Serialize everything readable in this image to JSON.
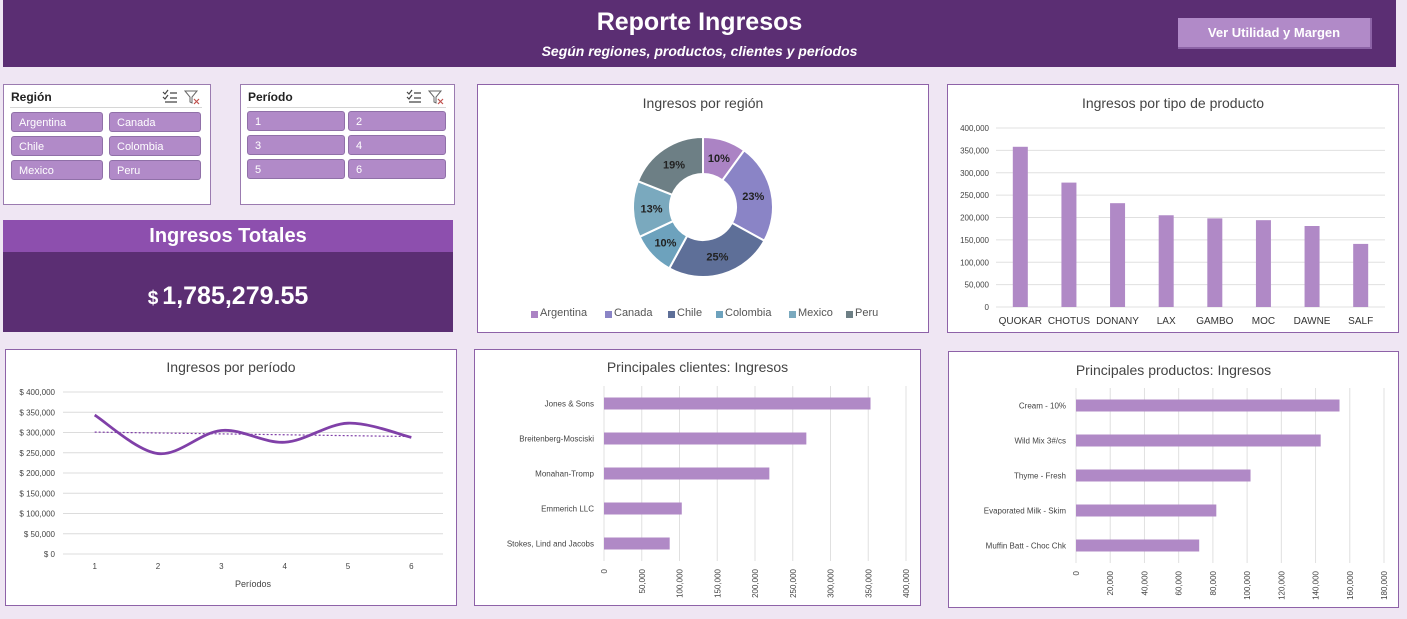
{
  "header": {
    "title": "Reporte Ingresos",
    "subtitle": "Según regiones, productos, clientes y períodos",
    "button_label": "Ver Utilidad y Margen"
  },
  "slicer_region": {
    "title": "Región",
    "items": [
      "Argentina",
      "Canada",
      "Chile",
      "Colombia",
      "Mexico",
      "Peru"
    ],
    "icons": [
      "multi-select-icon",
      "clear-filter-icon"
    ]
  },
  "slicer_periodo": {
    "title": "Período",
    "items": [
      "1",
      "2",
      "3",
      "4",
      "5",
      "6"
    ],
    "icons": [
      "multi-select-icon",
      "clear-filter-icon"
    ]
  },
  "kpi": {
    "title": "Ingresos Totales",
    "currency": "$",
    "value": "1,785,279.55"
  },
  "colors": {
    "header": "#5b2e73",
    "accent": "#b18ac8",
    "bar": "#b089c6",
    "line": "#8040a8",
    "background": "#efe6f3"
  },
  "chart_data": [
    {
      "id": "region",
      "type": "pie",
      "title": "Ingresos por región",
      "donut": true,
      "legend": "bottom",
      "labels": [
        "Argentina",
        "Canada",
        "Chile",
        "Colombia",
        "Mexico",
        "Peru"
      ],
      "values": [
        10,
        23,
        25,
        10,
        13,
        19
      ],
      "value_labels": [
        "10%",
        "23%",
        "25%",
        "10%",
        "13%",
        "19%"
      ],
      "colors": [
        "#ab83c4",
        "#8a84c6",
        "#5e6f98",
        "#6da2bd",
        "#7aa9be",
        "#6d7f85"
      ]
    },
    {
      "id": "producto",
      "type": "bar",
      "title": "Ingresos por tipo de producto",
      "orientation": "vertical",
      "categories": [
        "QUOKAR",
        "CHOTUS",
        "DONANY",
        "LAX",
        "GAMBO",
        "MOC",
        "DAWNE",
        "SALF"
      ],
      "values": [
        358000,
        278000,
        232000,
        205000,
        198000,
        194000,
        181000,
        141000
      ],
      "ylim": [
        0,
        400000
      ],
      "yticks": [
        "0",
        "50,000",
        "100,000",
        "150,000",
        "200,000",
        "250,000",
        "300,000",
        "350,000",
        "400,000"
      ],
      "grid": true
    },
    {
      "id": "periodo",
      "type": "line",
      "title": "Ingresos por período",
      "x": [
        "1",
        "2",
        "3",
        "4",
        "5",
        "6"
      ],
      "series": [
        {
          "values": [
            343000,
            248000,
            305000,
            276000,
            323000,
            288000
          ]
        }
      ],
      "trendline": [
        301000,
        290000
      ],
      "ylim": [
        0,
        400000
      ],
      "yticks": [
        "$ 0",
        "$ 50,000",
        "$ 100,000",
        "$ 150,000",
        "$ 200,000",
        "$ 250,000",
        "$ 300,000",
        "$ 350,000",
        "$ 400,000"
      ],
      "xlabel": "Períodos",
      "grid": true
    },
    {
      "id": "clientes",
      "type": "bar",
      "orientation": "horizontal",
      "title": "Principales clientes: Ingresos",
      "categories": [
        "Jones & Sons",
        "Breitenberg-Mosciski",
        "Monahan-Tromp",
        "Emmerich LLC",
        "Stokes, Lind and Jacobs"
      ],
      "values": [
        353000,
        268000,
        219000,
        103000,
        87000
      ],
      "xlim": [
        0,
        400000
      ],
      "xticks": [
        "0",
        "50,000",
        "100,000",
        "150,000",
        "200,000",
        "250,000",
        "300,000",
        "350,000",
        "400,000"
      ],
      "grid": true
    },
    {
      "id": "productos",
      "type": "bar",
      "orientation": "horizontal",
      "title": "Principales productos: Ingresos",
      "categories": [
        "Cream - 10%",
        "Wild Mix 3#/cs",
        "Thyme - Fresh",
        "Evaporated Milk - Skim",
        "Muffin Batt - Choc Chk"
      ],
      "values": [
        154000,
        143000,
        102000,
        82000,
        72000
      ],
      "xlim": [
        0,
        180000
      ],
      "xticks": [
        "0",
        "20,000",
        "40,000",
        "60,000",
        "80,000",
        "100,000",
        "120,000",
        "140,000",
        "160,000",
        "180,000"
      ],
      "grid": true
    }
  ]
}
